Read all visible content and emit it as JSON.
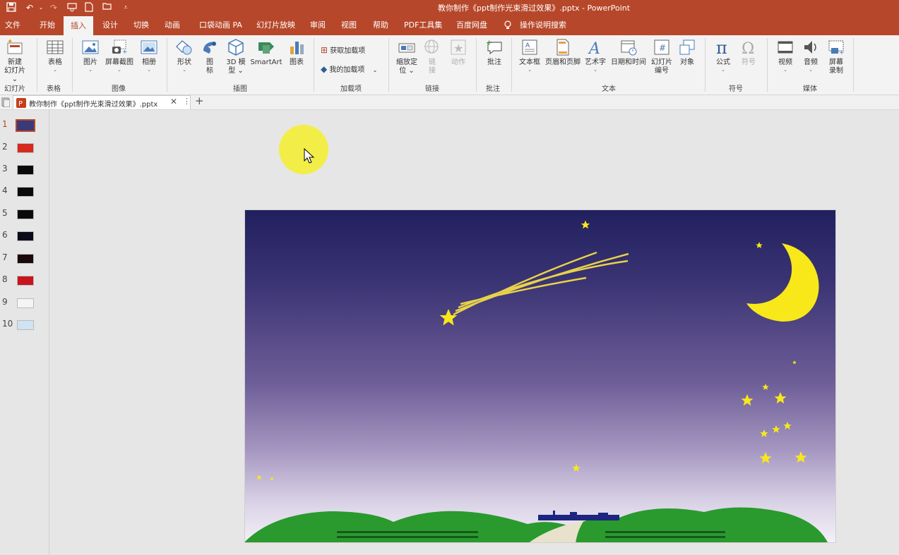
{
  "window": {
    "title": "教你制作《ppt制作光束滑过效果》.pptx  -  PowerPoint"
  },
  "quick_access": [
    "save-icon",
    "undo-icon",
    "redo-icon",
    "presenter-icon",
    "new-file-icon",
    "open-folder-icon",
    "customize-icon"
  ],
  "menu_tabs": [
    "文件",
    "开始",
    "插入",
    "设计",
    "切换",
    "动画",
    "口袋动画 PA",
    "幻灯片放映",
    "审阅",
    "视图",
    "帮助",
    "PDF工具集",
    "百度网盘",
    "操作说明搜索"
  ],
  "active_tab": "插入",
  "ribbon": {
    "groups": {
      "slides": "幻灯片",
      "tables": "表格",
      "images": "图像",
      "illustrations": "插图",
      "addins": "加载项",
      "links": "链接",
      "comments": "批注",
      "text": "文本",
      "symbols": "符号",
      "media": "媒体"
    },
    "buttons": {
      "new_slide_1": "新建",
      "new_slide_2": "幻灯片",
      "table": "表格",
      "picture": "图片",
      "screenshot": "屏幕截图",
      "album": "相册",
      "shapes": "形状",
      "icons_1": "图",
      "icons_2": "标",
      "model3d_1": "3D 模",
      "model3d_2": "型",
      "smartart": "SmartArt",
      "chart": "图表",
      "get_addins": "获取加载项",
      "my_addins": "我的加载项",
      "zoom_1": "缩放定",
      "zoom_2": "位",
      "link_1": "链",
      "link_2": "接",
      "action": "动作",
      "comment": "批注",
      "textbox": "文本框",
      "header_footer": "页眉和页脚",
      "wordart": "艺术字",
      "datetime": "日期和时间",
      "slide_number_1": "幻灯片",
      "slide_number_2": "编号",
      "object": "对象",
      "equation": "公式",
      "symbol": "符号",
      "video": "视频",
      "audio": "音频",
      "screen_record_1": "屏幕",
      "screen_record_2": "录制"
    }
  },
  "document_tab": {
    "label": "教你制作《ppt制作光束滑过效果》.pptx",
    "add": "+"
  },
  "slides": [
    {
      "number": "1",
      "color": "#3a3a7a"
    },
    {
      "number": "2",
      "color": "#d42b1e"
    },
    {
      "number": "3",
      "color": "#0a0a0a"
    },
    {
      "number": "4",
      "color": "#0a0a0a"
    },
    {
      "number": "5",
      "color": "#0a0a0a"
    },
    {
      "number": "6",
      "color": "#0a0a1a"
    },
    {
      "number": "7",
      "color": "#1a0a0a"
    },
    {
      "number": "8",
      "color": "#c8141e"
    },
    {
      "number": "9",
      "color": "#f4f4f4"
    },
    {
      "number": "10",
      "color": "#cfe3f2"
    }
  ],
  "selected_slide": "1",
  "colors": {
    "accent": "#b7472a",
    "star": "#f8e71c",
    "moon": "#f8e81a",
    "hill": "#2a9a2e"
  }
}
